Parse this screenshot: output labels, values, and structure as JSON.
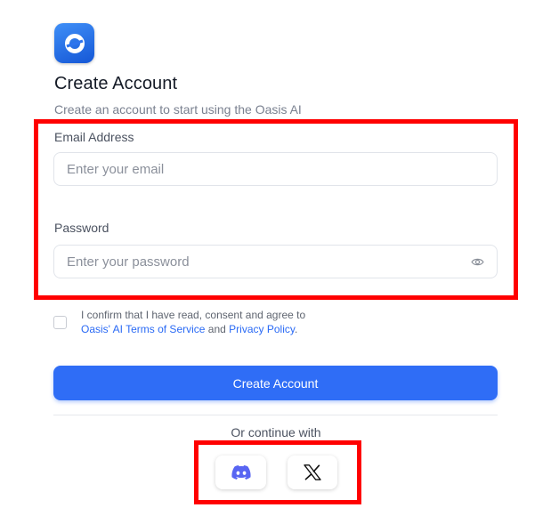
{
  "brand": {
    "logo_icon": "oasis-logo-icon",
    "accent_color": "#2f6df6"
  },
  "header": {
    "title": "Create Account",
    "subtitle": "Create an account to start using the Oasis AI"
  },
  "form": {
    "email": {
      "label": "Email Address",
      "placeholder": "Enter your email",
      "value": ""
    },
    "password": {
      "label": "Password",
      "placeholder": "Enter your password",
      "value": "",
      "toggle_icon": "eye-icon"
    },
    "consent": {
      "checked": false,
      "text_prefix": "I confirm that I have read, consent and agree to",
      "terms_link": "Oasis' AI Terms of Service",
      "conjunction": "and",
      "privacy_link": "Privacy Policy",
      "suffix": "."
    },
    "submit_label": "Create Account"
  },
  "social": {
    "heading": "Or continue with",
    "providers": [
      {
        "name": "Discord",
        "icon": "discord-icon"
      },
      {
        "name": "X",
        "icon": "x-icon"
      }
    ]
  },
  "annotations": {
    "highlight_color": "#ff0000"
  }
}
